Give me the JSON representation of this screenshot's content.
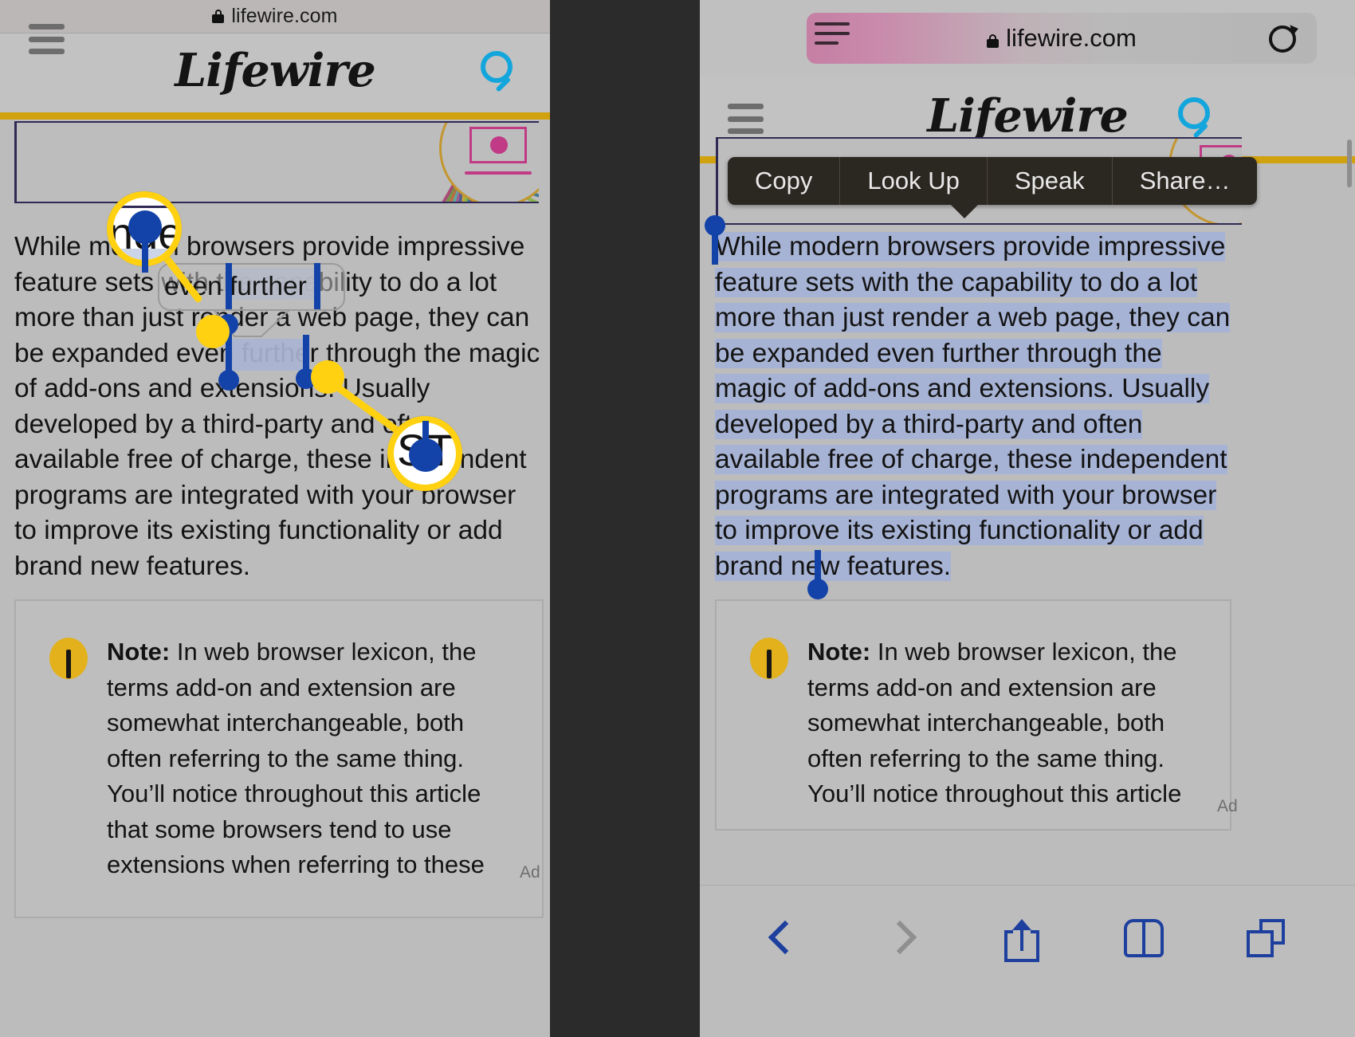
{
  "left_panel": {
    "url_bar": {
      "url": "lifewire.com",
      "lock_icon": "lock-icon"
    },
    "site_header": {
      "menu_icon": "hamburger-menu-icon",
      "logo": "Lifewire",
      "search_icon": "search-icon"
    },
    "article": {
      "paragraph": "While modern browsers provide impressive feature sets with the capability to do a lot more than just render a web page, they can be expanded even further through the magic of add-ons and extensions. Usually developed by a third-party and often available free of charge, these independent programs are integrated with your browser to improve its existing functionality or add brand new features.",
      "note_label": "Note:",
      "note_body": "In web browser lexicon, the terms add-on and extension are somewhat interchangeable, both often referring to the same thing. You’ll notice throughout this article that some browsers tend to use extensions when referring to these",
      "ad_label": "Ad"
    },
    "annotation": {
      "loupe_top_text": "nder",
      "loupe_bottom_text": "ST",
      "bubble_text": "even further",
      "highlight_color": "#a9b4d3",
      "handle_color": "#1343a8",
      "marker_color": "#ffd111"
    }
  },
  "right_panel": {
    "url_bar": {
      "url": "lifewire.com",
      "lock_icon": "lock-icon",
      "sidebar_icon": "sidebar-lines-icon",
      "reload_icon": "reload-icon"
    },
    "site_header": {
      "menu_icon": "hamburger-menu-icon",
      "logo": "Lifewire",
      "search_icon": "search-icon"
    },
    "edit_menu": {
      "items": [
        {
          "label": "Copy",
          "name": "copy"
        },
        {
          "label": "Look Up",
          "name": "look-up"
        },
        {
          "label": "Speak",
          "name": "speak"
        },
        {
          "label": "Share…",
          "name": "share"
        }
      ]
    },
    "article": {
      "selected_paragraph": "While modern browsers provide impressive feature sets with the capability to do a lot more than just render a web page, they can be expanded even further through the magic of add-ons and extensions. Usually developed by a third-party and often available free of charge, these independent programs are integrated with your browser to improve its existing functionality or add brand new features.",
      "note_label": "Note:",
      "note_body": "In web browser lexicon, the terms add-on and extension are somewhat interchangeable, both often referring to the same thing. You’ll notice throughout this article",
      "ad_label": "Ad"
    },
    "bottom_toolbar": {
      "items": [
        {
          "name": "back-button",
          "icon": "chevron-left-icon"
        },
        {
          "name": "forward-button",
          "icon": "chevron-right-icon"
        },
        {
          "name": "share-button",
          "icon": "share-icon"
        },
        {
          "name": "bookmarks-button",
          "icon": "book-icon"
        },
        {
          "name": "tabs-button",
          "icon": "tabs-icon"
        }
      ]
    }
  },
  "theme": {
    "page_background": "#bcbcbc",
    "divider_background": "#2b2b2b",
    "brand_gold": "#d1a210",
    "accent_blue": "#13a6dd",
    "toolbar_blue": "#1d3f9e",
    "menu_background": "#2b2721"
  }
}
